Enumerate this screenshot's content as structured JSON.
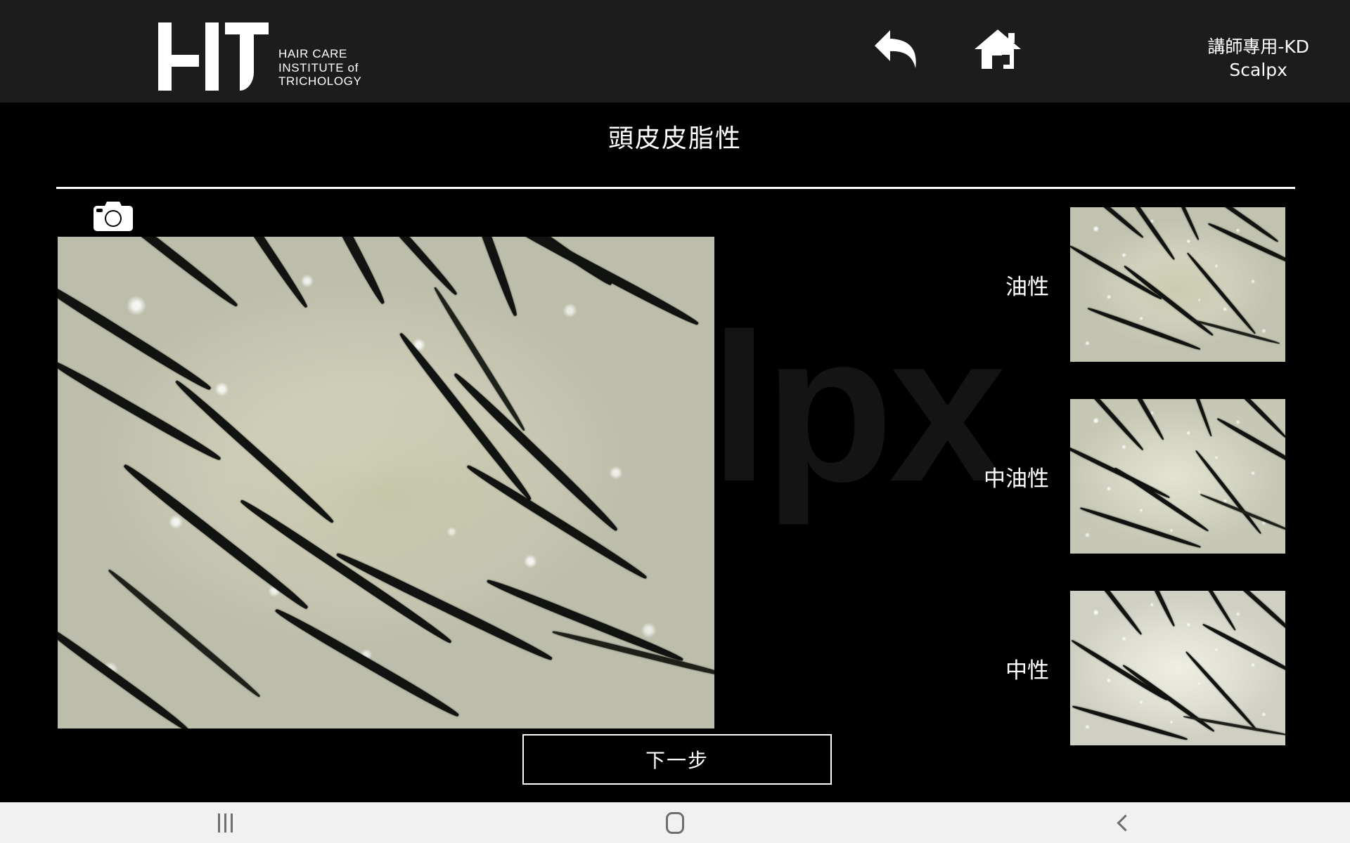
{
  "header": {
    "logo": {
      "mark": "HIT",
      "tagline_line1": "HAIR CARE",
      "tagline_line2": "INSTITUTE of",
      "tagline_line3": "TRICHOLOGY"
    },
    "back_icon": "back-arrow-icon",
    "home_icon": "home-icon",
    "user_role": "講師專用-KD",
    "app_name": "Scalpx"
  },
  "page": {
    "title": "頭皮皮脂性",
    "watermark": "lpx"
  },
  "capture": {
    "camera_icon": "camera-icon"
  },
  "levels": [
    {
      "label": "油性"
    },
    {
      "label": "中油性"
    },
    {
      "label": "中性"
    }
  ],
  "actions": {
    "next_label": "下一步"
  },
  "android_nav": {
    "recents_icon": "recents-icon",
    "home_icon": "home-square-icon",
    "back_icon": "back-chevron-icon"
  },
  "colors": {
    "header_bg": "#1c1c1c",
    "body_bg": "#000000",
    "text": "#ffffff",
    "divider": "#ffffff",
    "nav_bar_bg": "#f1f1f1",
    "nav_icon": "#6e6e6e"
  }
}
